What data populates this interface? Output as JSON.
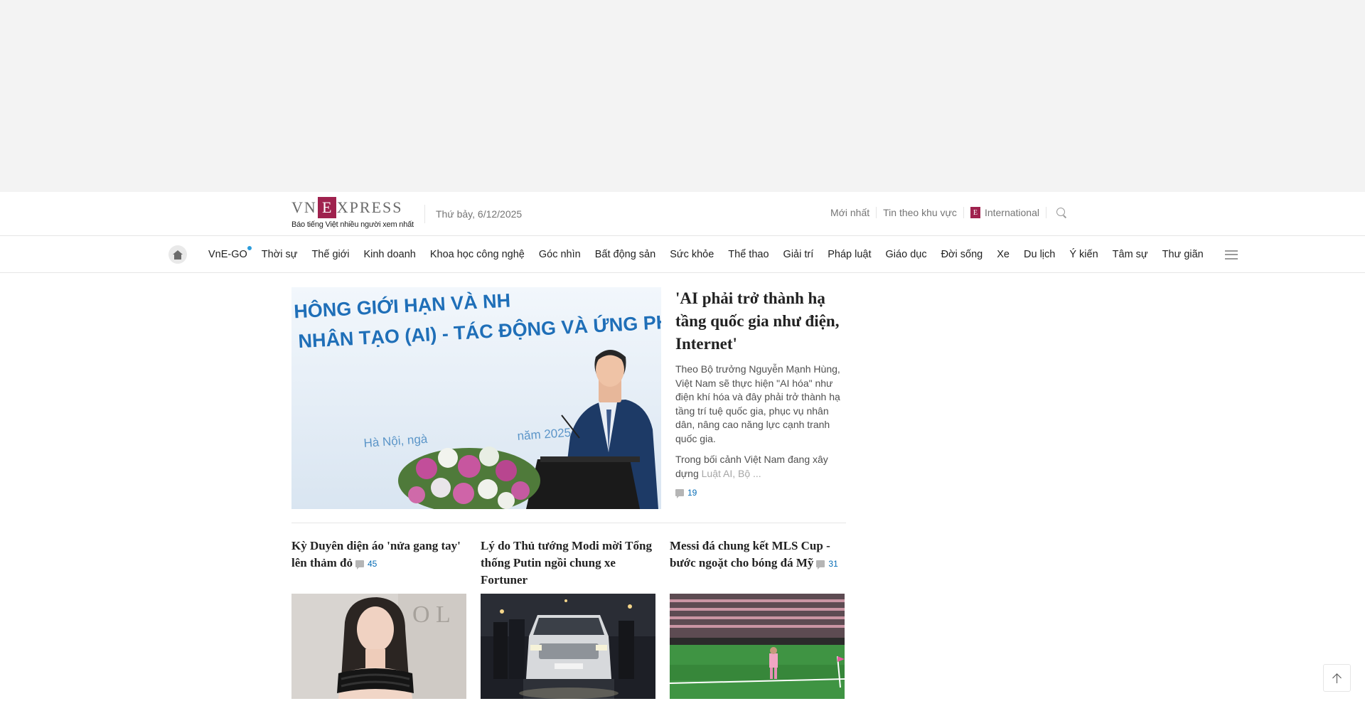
{
  "header": {
    "logo_left": "VN",
    "logo_box": "E",
    "logo_right": "XPRESS",
    "tagline": "Báo tiếng Việt nhiều người xem nhất",
    "date": "Thứ bảy, 6/12/2025",
    "links": {
      "latest": "Mới nhất",
      "regional": "Tin theo khu vực",
      "international": "International"
    }
  },
  "nav": {
    "items": [
      "VnE-GO",
      "Thời sự",
      "Thế giới",
      "Kinh doanh",
      "Khoa học công nghệ",
      "Góc nhìn",
      "Bất động sản",
      "Sức khỏe",
      "Thể thao",
      "Giải trí",
      "Pháp luật",
      "Giáo dục",
      "Đời sống",
      "Xe",
      "Du lịch",
      "Ý kiến",
      "Tâm sự",
      "Thư giãn"
    ]
  },
  "featured": {
    "title": "'AI phải trở thành hạ tầng quốc gia như điện, Internet'",
    "description": "Theo Bộ trưởng Nguyễn Mạnh Hùng, Việt Nam sẽ thực hiện \"AI hóa\" như điện khí hóa và đây phải trở thành hạ tầng trí tuệ quốc gia, phục vụ nhân dân, nâng cao năng lực cạnh tranh quốc gia.",
    "more_text": "Trong bối cảnh Việt Nam đang xây dựng",
    "more_faded": "Luật AI, Bộ ...",
    "comments": "19",
    "image_text_line1": "HÔNG GIỚI HẠN VÀ NH",
    "image_text_line2": "NHÂN TẠO (AI) - TÁC ĐỘNG VÀ ỨNG PH",
    "image_text_line3": "Hà Nội, ngà",
    "image_text_line4": "năm 2025"
  },
  "articles": [
    {
      "title": "Kỳ Duyên diện áo 'nửa gang tay' lên thảm đỏ",
      "comments": "45"
    },
    {
      "title": "Lý do Thủ tướng Modi mời Tổng thống Putin ngồi chung xe Fortuner",
      "comments": ""
    },
    {
      "title": "Messi đá chung kết MLS Cup - bước ngoặt cho bóng đá Mỹ",
      "comments": "31"
    }
  ],
  "colors": {
    "brand": "#9f224e",
    "link_blue": "#076db6",
    "text_gray": "#757575"
  }
}
